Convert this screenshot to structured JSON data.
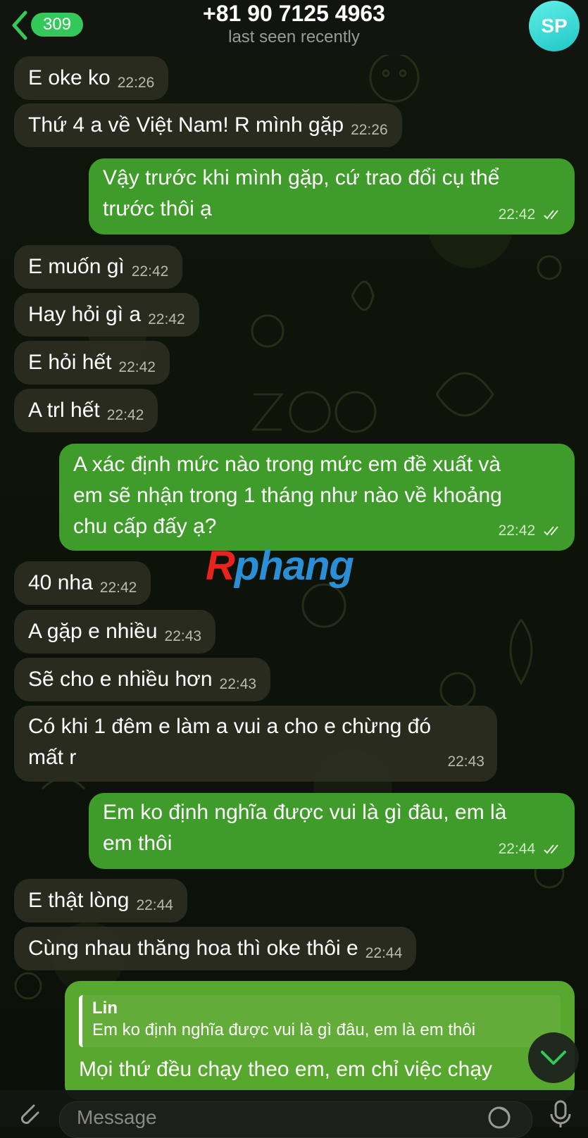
{
  "header": {
    "back_count": "309",
    "title": "+81 90 7125 4963",
    "status": "last seen recently",
    "avatar_initials": "SP"
  },
  "messages": [
    {
      "dir": "in",
      "text": "E oke ko",
      "time": "22:26"
    },
    {
      "dir": "in",
      "text": "Thứ 4 a về Việt Nam! R mình gặp",
      "time": "22:26"
    },
    {
      "dir": "out",
      "lines": [
        "Vậy trước khi mình gặp, cứ trao đổi cụ thể",
        "trước thôi ạ"
      ],
      "time": "22:42"
    },
    {
      "dir": "in",
      "text": "E muốn gì",
      "time": "22:42"
    },
    {
      "dir": "in",
      "text": "Hay hỏi gì a",
      "time": "22:42"
    },
    {
      "dir": "in",
      "text": "E hỏi hết",
      "time": "22:42"
    },
    {
      "dir": "in",
      "text": "A trl hết",
      "time": "22:42"
    },
    {
      "dir": "out",
      "lines": [
        "A xác định mức nào trong mức em đề xuất và",
        "em sẽ nhận trong 1 tháng như nào về khoảng",
        "chu cấp đấy ạ?"
      ],
      "time": "22:42"
    },
    {
      "dir": "in",
      "text": "40 nha",
      "time": "22:42"
    },
    {
      "dir": "in",
      "text": "A gặp e nhiều",
      "time": "22:43"
    },
    {
      "dir": "in",
      "text": "Sẽ cho e nhiều hơn",
      "time": "22:43"
    },
    {
      "dir": "in",
      "lines": [
        "Có khi 1 đêm e làm a vui a cho e chừng đó",
        "mất r"
      ],
      "time": "22:43"
    },
    {
      "dir": "out",
      "lines": [
        "Em ko định nghĩa được vui là gì đâu, em là",
        "em thôi"
      ],
      "time": "22:44"
    },
    {
      "dir": "in",
      "text": "E thật lòng",
      "time": "22:44"
    },
    {
      "dir": "in",
      "text": "Cùng nhau thăng hoa thì oke thôi e",
      "time": "22:44"
    }
  ],
  "reply": {
    "quote_name": "Lin",
    "quote_text": "Em ko định nghĩa được vui là gì đâu, em là em thôi",
    "text": "Mọi thứ đều chạy theo em, em chỉ việc chạy"
  },
  "watermark": {
    "first": "R",
    "rest": "phang"
  },
  "input": {
    "placeholder": "Message"
  },
  "colors": {
    "outgoing": "#3f9b2a",
    "incoming": "#2c2e22",
    "accent": "#34c759",
    "avatar": "#3ee0da"
  },
  "icons": [
    "chevron-left-icon",
    "chevron-down-icon",
    "paperclip-icon",
    "sticker-icon",
    "microphone-icon",
    "double-check-icon"
  ]
}
